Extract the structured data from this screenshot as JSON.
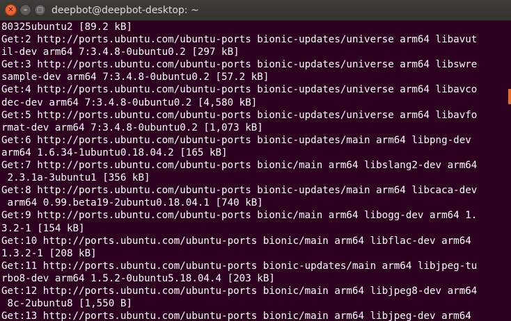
{
  "window": {
    "title": "deepbot@deepbot-desktop: ~",
    "close_glyph": "✕",
    "minimize_glyph": "–",
    "maximize_glyph": "□"
  },
  "terminal": {
    "lines": [
      "80325ubuntu2 [89.2 kB]",
      "Get:2 http://ports.ubuntu.com/ubuntu-ports bionic-updates/universe arm64 libavut",
      "il-dev arm64 7:3.4.8-0ubuntu0.2 [297 kB]",
      "Get:3 http://ports.ubuntu.com/ubuntu-ports bionic-updates/universe arm64 libswre",
      "sample-dev arm64 7:3.4.8-0ubuntu0.2 [57.2 kB]",
      "Get:4 http://ports.ubuntu.com/ubuntu-ports bionic-updates/universe arm64 libavco",
      "dec-dev arm64 7:3.4.8-0ubuntu0.2 [4,580 kB]",
      "Get:5 http://ports.ubuntu.com/ubuntu-ports bionic-updates/universe arm64 libavfo",
      "rmat-dev arm64 7:3.4.8-0ubuntu0.2 [1,073 kB]",
      "Get:6 http://ports.ubuntu.com/ubuntu-ports bionic-updates/main arm64 libpng-dev",
      "arm64 1.6.34-1ubuntu0.18.04.2 [165 kB]",
      "Get:7 http://ports.ubuntu.com/ubuntu-ports bionic/main arm64 libslang2-dev arm64",
      " 2.3.1a-3ubuntu1 [356 kB]",
      "Get:8 http://ports.ubuntu.com/ubuntu-ports bionic-updates/main arm64 libcaca-dev",
      " arm64 0.99.beta19-2ubuntu0.18.04.1 [740 kB]",
      "Get:9 http://ports.ubuntu.com/ubuntu-ports bionic/main arm64 libogg-dev arm64 1.",
      "3.2-1 [154 kB]",
      "Get:10 http://ports.ubuntu.com/ubuntu-ports bionic/main arm64 libflac-dev arm64",
      "1.3.2-1 [208 kB]",
      "Get:11 http://ports.ubuntu.com/ubuntu-ports bionic-updates/main arm64 libjpeg-tu",
      "rbo8-dev arm64 1.5.2-0ubuntu5.18.04.4 [203 kB]",
      "Get:12 http://ports.ubuntu.com/ubuntu-ports bionic/main arm64 libjpeg8-dev arm64",
      " 8c-2ubuntu8 [1,550 B]",
      "Get:13 http://ports.ubuntu.com/ubuntu-ports bionic/main arm64 libjpeg-dev arm64"
    ]
  },
  "colors": {
    "terminal_background": "#2c001e",
    "terminal_text": "#ffffff",
    "titlebar": "#3c3b37",
    "close_button": "#e95420",
    "scroll_marker": "#e06d2f"
  }
}
